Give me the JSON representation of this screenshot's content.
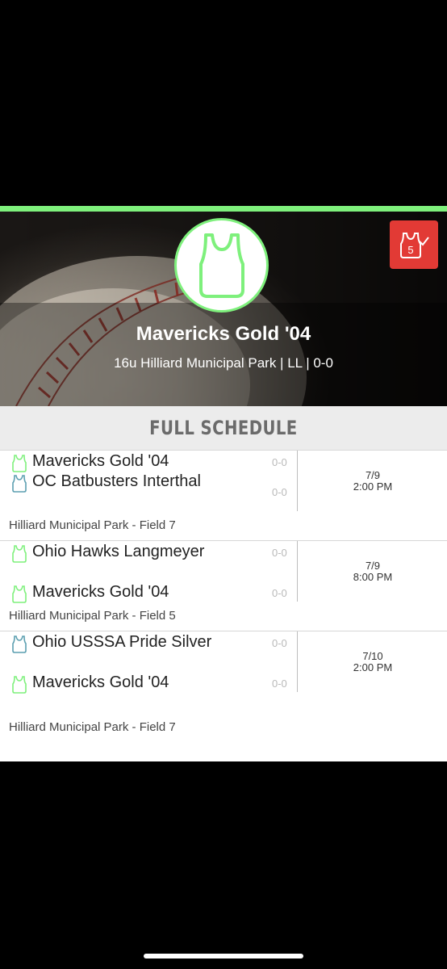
{
  "team": {
    "name": "Mavericks Gold '04",
    "subtitle": "16u Hilliard Municipal Park | LL | 0-0",
    "badge_number": "5"
  },
  "schedule": {
    "header": "FULL SCHEDULE",
    "games": [
      {
        "teams": [
          {
            "name": "Mavericks Gold '04",
            "score": "0-0",
            "jersey_color": "#7ef07c"
          },
          {
            "name": "OC Batbusters Interthal",
            "score": "0-0",
            "jersey_color": "#5b9fb0"
          }
        ],
        "date": "7/9",
        "time": "2:00 PM",
        "venue": "Hilliard Municipal Park - Field 7"
      },
      {
        "teams": [
          {
            "name": "Ohio Hawks Langmeyer",
            "score": "0-0",
            "jersey_color": "#7ef07c"
          },
          {
            "name": "Mavericks Gold '04",
            "score": "0-0",
            "jersey_color": "#7ef07c"
          }
        ],
        "date": "7/9",
        "time": "8:00 PM",
        "venue": "Hilliard Municipal Park - Field 5"
      },
      {
        "teams": [
          {
            "name": "Ohio USSSA Pride Silver",
            "score": "0-0",
            "jersey_color": "#5b9fb0"
          },
          {
            "name": "Mavericks Gold '04",
            "score": "0-0",
            "jersey_color": "#7ef07c"
          }
        ],
        "date": "7/10",
        "time": "2:00 PM",
        "venue": "Hilliard Municipal Park - Field 7"
      }
    ]
  },
  "colors": {
    "accent": "#7ef07c",
    "badge": "#e23a35"
  },
  "icons": [
    "jersey-icon",
    "checkin-badge-icon"
  ]
}
